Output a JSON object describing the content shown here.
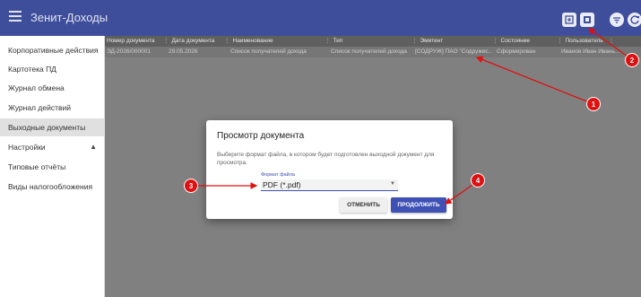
{
  "app": {
    "title": "Зенит-Доходы"
  },
  "colors": {
    "accent": "#3f51b5",
    "topbar": "#3f4e9a",
    "annotation": "#e01010"
  },
  "toolbar": {
    "icons": [
      "document-export-icon",
      "document-preview-icon",
      "filter-icon",
      "refresh-icon"
    ]
  },
  "sidebar": {
    "items": [
      {
        "label": "Корпоративные действия"
      },
      {
        "label": "Картотека ПД"
      },
      {
        "label": "Журнал обмена"
      },
      {
        "label": "Журнал действий"
      },
      {
        "label": "Выходные документы",
        "active": true
      },
      {
        "label": "Настройки",
        "expandable": true
      },
      {
        "label": "Типовые отчёты"
      },
      {
        "label": "Виды налогообложения"
      }
    ]
  },
  "table": {
    "columns": [
      "Номер документа",
      "Дата документа",
      "Наименование",
      "Тип",
      "Эмитент",
      "Состояние",
      "Пользователь"
    ],
    "rows": [
      [
        "ЭД-2026/000001",
        "29.05.2026",
        "Список получателей дохода",
        "Список получателей дохода",
        "[СОДРУЖ] ПАО \"Содружес...",
        "Сформирован",
        "Иванов Иван Ивань..."
      ]
    ]
  },
  "dialog": {
    "title": "Просмотр документа",
    "description": "Выберите формат файла, в котором будет подготовлен выходной документ для просмотра.",
    "field_label": "Формат файла",
    "field_value": "PDF (*.pdf)",
    "cancel_label": "ОТМЕНИТЬ",
    "continue_label": "ПРОДОЛЖИТЬ"
  },
  "annotations": {
    "labels": [
      "1",
      "2",
      "3",
      "4"
    ]
  }
}
